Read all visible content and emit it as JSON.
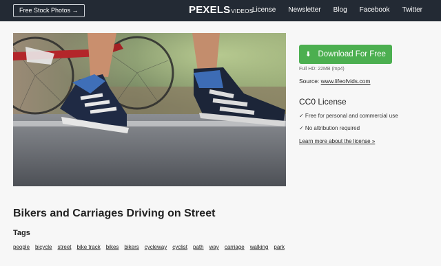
{
  "header": {
    "stock_button": "Free Stock Photos →",
    "logo_main": "PEXELS",
    "logo_sub": "VIDEOS",
    "nav": [
      "License",
      "Newsletter",
      "Blog",
      "Facebook",
      "Twitter"
    ]
  },
  "sidebar": {
    "download_label": "Download For Free",
    "file_info": "Full HD: 22MB (mp4)",
    "source_label": "Source:",
    "source_link": "www.lifeofvids.com",
    "license_title": "CC0 License",
    "license_items": [
      "✓ Free for personal and commercial use",
      "✓ No attribution required"
    ],
    "license_link": "Learn more about the license »"
  },
  "main": {
    "title": "Bikers and Carriages Driving on Street",
    "tags_heading": "Tags",
    "tags": [
      "people",
      "bicycle",
      "street",
      "bike track",
      "bikes",
      "bikers",
      "cycleway",
      "cyclist",
      "path",
      "way",
      "carriage",
      "walking",
      "park"
    ]
  },
  "colors": {
    "topbar": "#232a34",
    "download": "#4caf50",
    "background": "#f7f7f7"
  }
}
